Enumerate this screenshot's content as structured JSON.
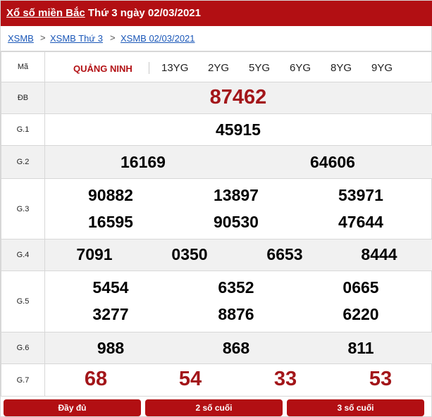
{
  "header": {
    "title_link": "Xổ số miền Bắc",
    "title_rest": "Thứ 3 ngày 02/03/2021"
  },
  "breadcrumb": {
    "items": [
      "XSMB",
      "XSMB Thứ 3",
      "XSMB 02/03/2021"
    ],
    "separator": ">"
  },
  "table": {
    "code_label": "Mã",
    "province": "QUẢNG NINH",
    "codes": [
      "13YG",
      "2YG",
      "5YG",
      "6YG",
      "8YG",
      "9YG"
    ],
    "prizes": [
      {
        "label": "ĐB",
        "numbers": [
          "87462"
        ]
      },
      {
        "label": "G.1",
        "numbers": [
          "45915"
        ]
      },
      {
        "label": "G.2",
        "numbers": [
          "16169",
          "64606"
        ]
      },
      {
        "label": "G.3",
        "numbers": [
          "90882",
          "13897",
          "53971",
          "16595",
          "90530",
          "47644"
        ]
      },
      {
        "label": "G.4",
        "numbers": [
          "7091",
          "0350",
          "6653",
          "8444"
        ]
      },
      {
        "label": "G.5",
        "numbers": [
          "5454",
          "6352",
          "0665",
          "3277",
          "8876",
          "6220"
        ]
      },
      {
        "label": "G.6",
        "numbers": [
          "988",
          "868",
          "811"
        ]
      },
      {
        "label": "G.7",
        "numbers": [
          "68",
          "54",
          "33",
          "53"
        ]
      }
    ]
  },
  "footer": {
    "buttons": [
      "Đầy đủ",
      "2 số cuối",
      "3 số cuối"
    ]
  },
  "colors": {
    "brand_red": "#b20f13",
    "prize_red": "#a3161a",
    "link_blue": "#1a57b8",
    "alt_row": "#f1f1f1"
  }
}
